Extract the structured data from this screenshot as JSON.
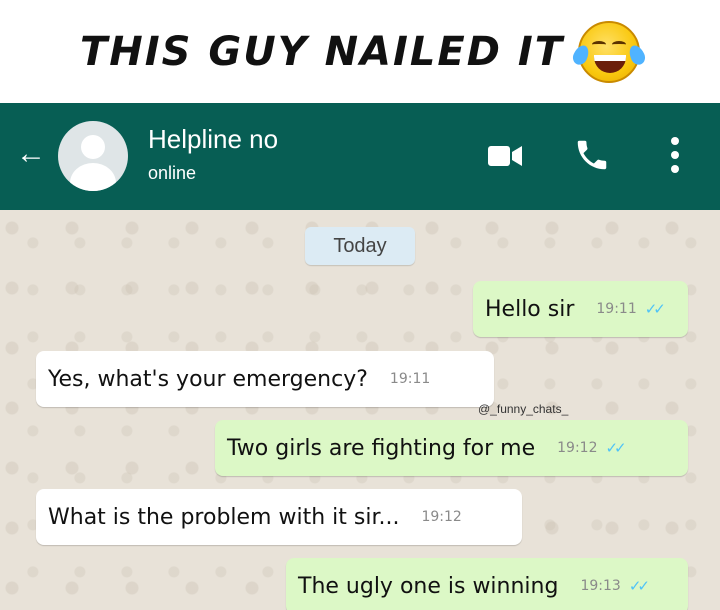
{
  "caption": {
    "text": "THIS GUY NAILED IT",
    "emoji": "laughing-with-tears-emoji"
  },
  "header": {
    "back_icon": "←",
    "contact_name": "Helpline no",
    "status": "online",
    "icons": [
      "video-call-icon",
      "voice-call-icon",
      "more-options-icon"
    ],
    "color": "#075e54"
  },
  "chat": {
    "date_label": "Today",
    "watermark": "@_funny_chats_",
    "messages": [
      {
        "direction": "out",
        "text": "Hello sir",
        "time": "19:11",
        "ticks": "✓✓"
      },
      {
        "direction": "in",
        "text": "Yes, what's your emergency?",
        "time": "19:11"
      },
      {
        "direction": "out",
        "text": "Two girls are fighting for me",
        "time": "19:12",
        "ticks": "✓✓"
      },
      {
        "direction": "in",
        "text": "What is the problem with it sir...",
        "time": "19:12"
      },
      {
        "direction": "out",
        "text": "The ugly one is winning",
        "time": "19:13",
        "ticks": "✓✓"
      }
    ],
    "outgoing_bubble_color": "#dcf8c6",
    "incoming_bubble_color": "#ffffff"
  }
}
